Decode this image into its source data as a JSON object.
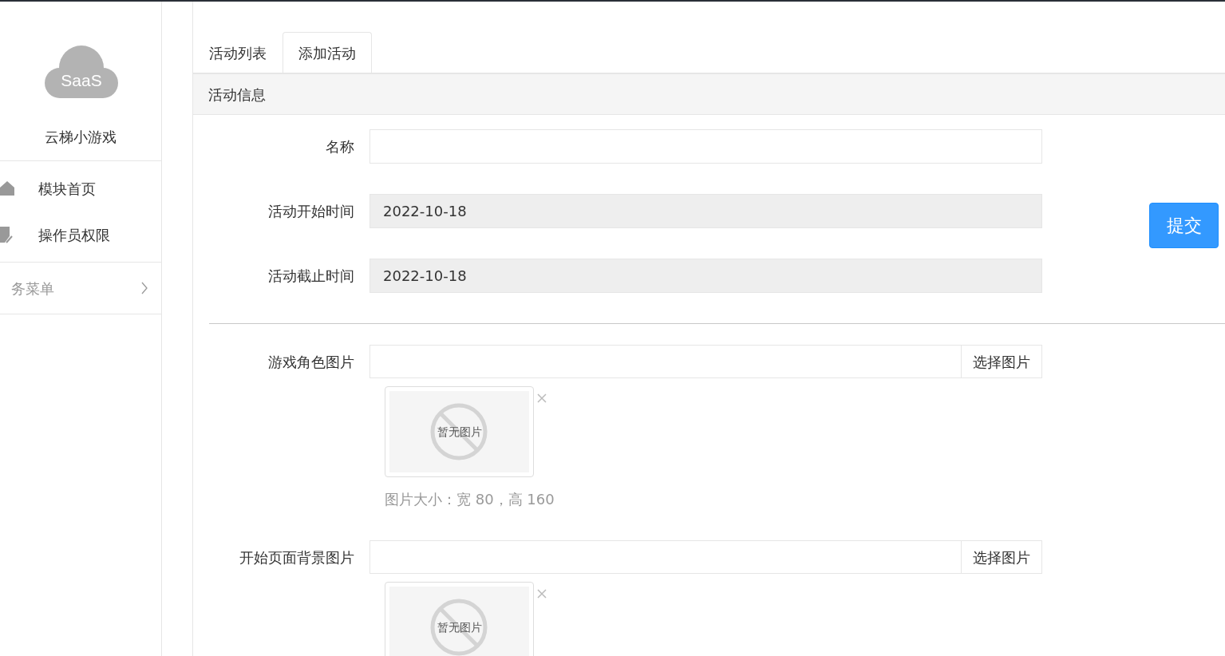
{
  "sidebar": {
    "logo_text": "SaaS",
    "app_name": "云梯小游戏",
    "items": [
      {
        "label": "模块首页"
      },
      {
        "label": "操作员权限"
      }
    ],
    "group": {
      "label": "务菜单",
      "expanded": false
    }
  },
  "tabs": [
    {
      "label": "活动列表",
      "selected": false
    },
    {
      "label": "添加活动",
      "selected": true
    }
  ],
  "panel": {
    "title": "活动信息",
    "fields": [
      {
        "kind": "text",
        "label": "名称"
      },
      {
        "kind": "date",
        "label": "活动开始时间",
        "value": "2022-10-18"
      },
      {
        "kind": "date",
        "label": "活动截止时间",
        "value": "2022-10-18"
      },
      {
        "kind": "divider"
      },
      {
        "kind": "image",
        "label": "游戏角色图片",
        "button": "选择图片",
        "empty_text": "暂无图片",
        "hint": "图片大小：宽 80，高 160"
      },
      {
        "kind": "image",
        "label": "开始页面背景图片",
        "button": "选择图片",
        "empty_text": "暂无图片"
      }
    ]
  },
  "submit": "提交"
}
